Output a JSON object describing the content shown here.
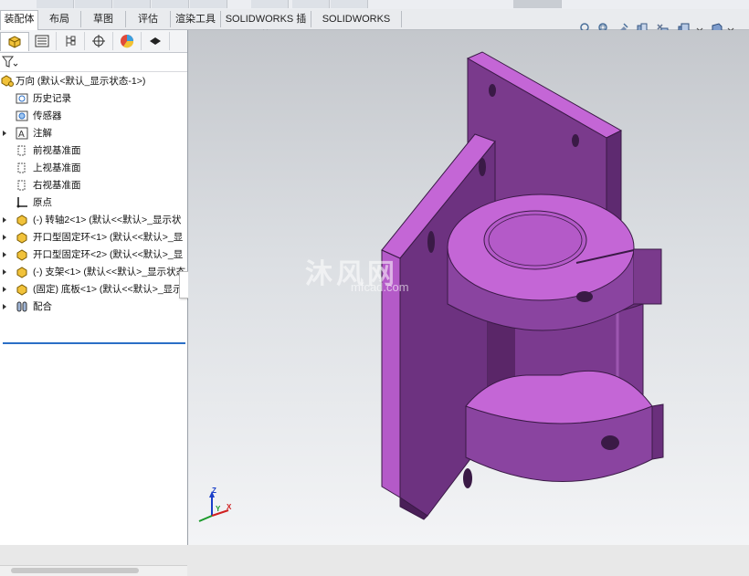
{
  "top_strip": {
    "partial_label": ""
  },
  "tabs": [
    {
      "label": "装配体",
      "active": true
    },
    {
      "label": "布局",
      "active": false
    },
    {
      "label": "草图",
      "active": false
    },
    {
      "label": "评估",
      "active": false
    },
    {
      "label": "渲染工具",
      "active": false
    },
    {
      "label": "SOLIDWORKS 插件",
      "active": false
    },
    {
      "label": "SOLIDWORKS MBD",
      "active": false
    }
  ],
  "heads_up_icons": [
    "zoom-to-fit-icon",
    "zoom-area-icon",
    "previous-view-icon",
    "section-view-icon",
    "view-orientation-icon",
    "display-style-icon",
    "hide-show-icon",
    "edit-appearance-icon"
  ],
  "panel_tabs": [
    "feature-manager-icon",
    "property-manager-icon",
    "configuration-manager-icon",
    "dimxpert-icon",
    "display-manager-icon",
    "cam-icon"
  ],
  "tree": {
    "root": "万向  (默认<默认_显示状态-1>)",
    "items": [
      {
        "label": "历史记录",
        "icon": "history-icon",
        "expandable": false
      },
      {
        "label": "传感器",
        "icon": "sensor-icon",
        "expandable": false
      },
      {
        "label": "注解",
        "icon": "annotation-icon",
        "expandable": true
      },
      {
        "label": "前视基准面",
        "icon": "plane-icon",
        "expandable": false
      },
      {
        "label": "上视基准面",
        "icon": "plane-icon",
        "expandable": false
      },
      {
        "label": "右视基准面",
        "icon": "plane-icon",
        "expandable": false
      },
      {
        "label": "原点",
        "icon": "origin-icon",
        "expandable": false
      },
      {
        "label": "(-) 转轴2<1> (默认<<默认>_显示状",
        "icon": "part-icon",
        "expandable": true
      },
      {
        "label": "开口型固定环<1> (默认<<默认>_显",
        "icon": "part-icon",
        "expandable": true
      },
      {
        "label": "开口型固定环<2> (默认<<默认>_显",
        "icon": "part-icon",
        "expandable": true
      },
      {
        "label": "(-) 支架<1> (默认<<默认>_显示状态",
        "icon": "part-icon",
        "expandable": true
      },
      {
        "label": "(固定) 底板<1> (默认<<默认>_显示",
        "icon": "part-icon",
        "expandable": true
      },
      {
        "label": "配合",
        "icon": "mates-icon",
        "expandable": true
      }
    ]
  },
  "watermark": {
    "main": "沐风网",
    "sub": "mfcad.com"
  },
  "triad": {
    "x": "X",
    "y": "Y",
    "z": "Z"
  },
  "colors": {
    "part": "#b45ac8",
    "part_dark": "#5e2a70",
    "part_top": "#c466d6",
    "tab_active_bg": "#ffffff",
    "accent_line": "#2b6fc6"
  }
}
